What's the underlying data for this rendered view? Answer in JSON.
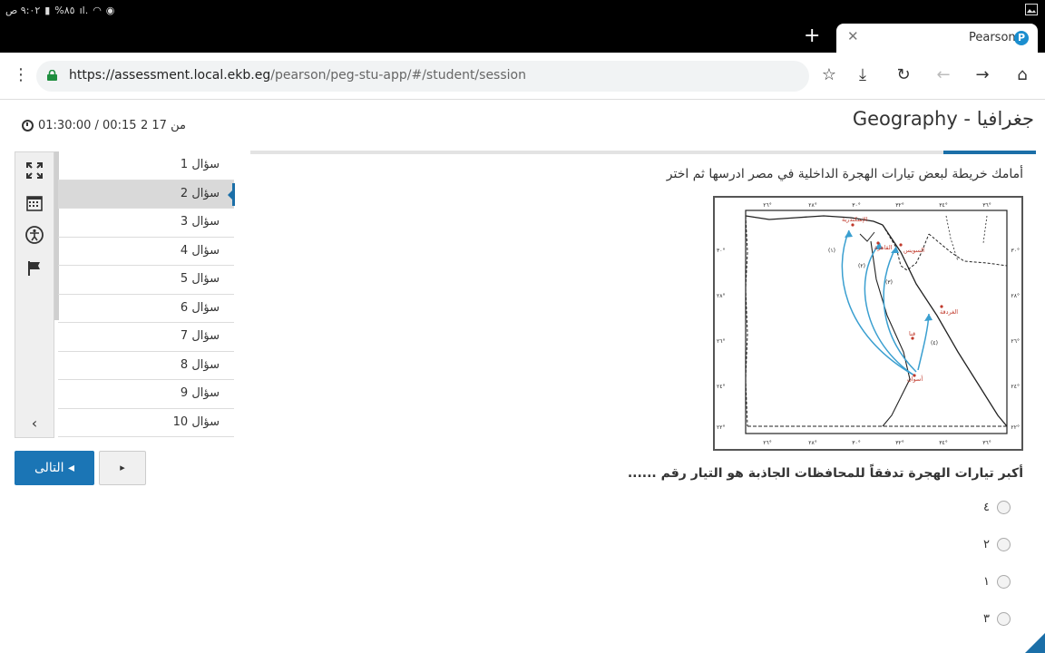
{
  "status_bar": {
    "time": "٩:٠٢ ص",
    "battery": "%٨٥",
    "network": "ıl."
  },
  "browser": {
    "tab_title": "Pearson",
    "favicon_letter": "P",
    "url_host": "https://assessment.local.ekb.eg",
    "url_path": "/pearson/peg-stu-app/#/student/session"
  },
  "header": {
    "subject": "Geography - جغرافيا",
    "progress": "2 من 17",
    "timer": "01:30:00 / 00:15"
  },
  "nav": {
    "questions": [
      {
        "label": "سؤال 1"
      },
      {
        "label": "سؤال 2"
      },
      {
        "label": "سؤال 3"
      },
      {
        "label": "سؤال 4"
      },
      {
        "label": "سؤال 5"
      },
      {
        "label": "سؤال 6"
      },
      {
        "label": "سؤال 7"
      },
      {
        "label": "سؤال 8"
      },
      {
        "label": "سؤال 9"
      },
      {
        "label": "سؤال 10"
      }
    ],
    "active_index": 1,
    "next_label": "التالى ◂",
    "play_label": "▸"
  },
  "question": {
    "prompt": "أمامك خريطة لبعض تيارات الهجرة الداخلية في مصر ادرسها ثم اختر",
    "text": "أكبر تيارات الهجرة تدفقاً للمحافظات الجاذبة هو التيار رقم ......",
    "options": [
      {
        "label": "٤"
      },
      {
        "label": "٢"
      },
      {
        "label": "١"
      },
      {
        "label": "٣"
      }
    ]
  },
  "map": {
    "top_ticks": [
      "٢٦°",
      "٢٨°",
      "٣٠°",
      "٣٢°",
      "٣٤°",
      "٣٦°"
    ],
    "bottom_ticks": [
      "٢٦°",
      "٢٨°",
      "٣٠°",
      "٣٢°",
      "٣٤°",
      "٣٦°"
    ],
    "left_ticks": [
      "٣٠°",
      "٢٨°",
      "٢٦°",
      "٢٤°",
      "٢٢°"
    ],
    "right_ticks": [
      "٣٠°",
      "٢٨°",
      "٢٦°",
      "٢٤°",
      "٢٢°"
    ],
    "cities": {
      "alexandria": "الإسكندرية",
      "cairo": "القاهرة",
      "suez": "السويس",
      "hurghada": "الغردقة",
      "qena": "قنا",
      "aswan": "أسوان"
    },
    "stream_labels": [
      "(١)",
      "(٢)",
      "(٣)",
      "(٤)"
    ],
    "colors": {
      "arrow": "#3a9fd0",
      "city": "#c0392b"
    }
  }
}
